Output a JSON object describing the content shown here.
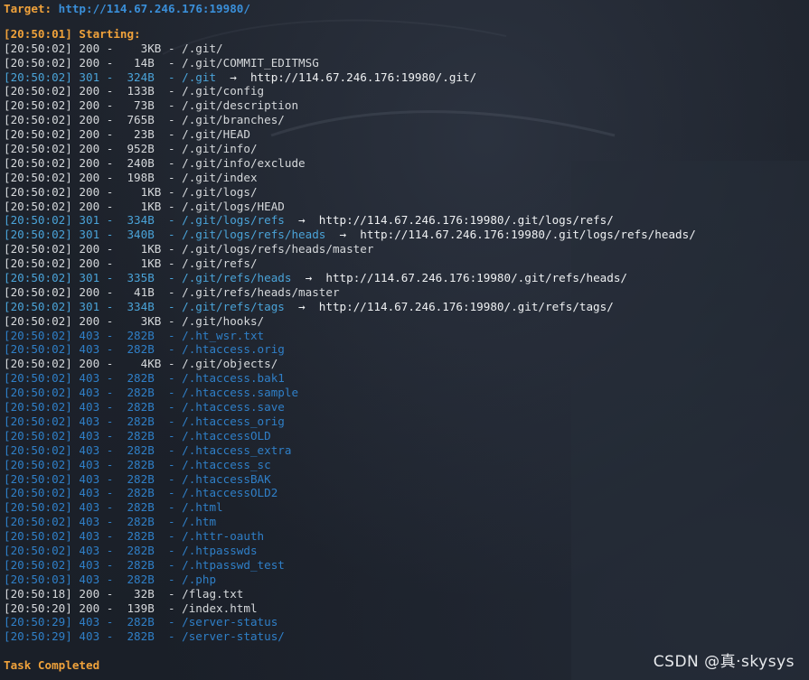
{
  "target_label": "Target:",
  "target_url": "http://114.67.246.176:19980/",
  "starting": "[20:50:01] Starting:",
  "lines": [
    {
      "code": "200",
      "t": "[20:50:02] 200 -    3KB - /.git/"
    },
    {
      "code": "200",
      "t": "[20:50:02] 200 -   14B  - /.git/COMMIT_EDITMSG"
    },
    {
      "code": "301",
      "t": "[20:50:02] 301 -  324B  - /.git  →  http://114.67.246.176:19980/.git/"
    },
    {
      "code": "200",
      "t": "[20:50:02] 200 -  133B  - /.git/config"
    },
    {
      "code": "200",
      "t": "[20:50:02] 200 -   73B  - /.git/description"
    },
    {
      "code": "200",
      "t": "[20:50:02] 200 -  765B  - /.git/branches/"
    },
    {
      "code": "200",
      "t": "[20:50:02] 200 -   23B  - /.git/HEAD"
    },
    {
      "code": "200",
      "t": "[20:50:02] 200 -  952B  - /.git/info/"
    },
    {
      "code": "200",
      "t": "[20:50:02] 200 -  240B  - /.git/info/exclude"
    },
    {
      "code": "200",
      "t": "[20:50:02] 200 -  198B  - /.git/index"
    },
    {
      "code": "200",
      "t": "[20:50:02] 200 -    1KB - /.git/logs/"
    },
    {
      "code": "200",
      "t": "[20:50:02] 200 -    1KB - /.git/logs/HEAD"
    },
    {
      "code": "301",
      "t": "[20:50:02] 301 -  334B  - /.git/logs/refs  →  http://114.67.246.176:19980/.git/logs/refs/"
    },
    {
      "code": "301",
      "t": "[20:50:02] 301 -  340B  - /.git/logs/refs/heads  →  http://114.67.246.176:19980/.git/logs/refs/heads/"
    },
    {
      "code": "200",
      "t": "[20:50:02] 200 -    1KB - /.git/logs/refs/heads/master"
    },
    {
      "code": "200",
      "t": "[20:50:02] 200 -    1KB - /.git/refs/"
    },
    {
      "code": "301",
      "t": "[20:50:02] 301 -  335B  - /.git/refs/heads  →  http://114.67.246.176:19980/.git/refs/heads/"
    },
    {
      "code": "200",
      "t": "[20:50:02] 200 -   41B  - /.git/refs/heads/master"
    },
    {
      "code": "301",
      "t": "[20:50:02] 301 -  334B  - /.git/refs/tags  →  http://114.67.246.176:19980/.git/refs/tags/"
    },
    {
      "code": "200",
      "t": "[20:50:02] 200 -    3KB - /.git/hooks/"
    },
    {
      "code": "403",
      "t": "[20:50:02] 403 -  282B  - /.ht_wsr.txt"
    },
    {
      "code": "403",
      "t": "[20:50:02] 403 -  282B  - /.htaccess.orig"
    },
    {
      "code": "200",
      "t": "[20:50:02] 200 -    4KB - /.git/objects/"
    },
    {
      "code": "403",
      "t": "[20:50:02] 403 -  282B  - /.htaccess.bak1"
    },
    {
      "code": "403",
      "t": "[20:50:02] 403 -  282B  - /.htaccess.sample"
    },
    {
      "code": "403",
      "t": "[20:50:02] 403 -  282B  - /.htaccess.save"
    },
    {
      "code": "403",
      "t": "[20:50:02] 403 -  282B  - /.htaccess_orig"
    },
    {
      "code": "403",
      "t": "[20:50:02] 403 -  282B  - /.htaccessOLD"
    },
    {
      "code": "403",
      "t": "[20:50:02] 403 -  282B  - /.htaccess_extra"
    },
    {
      "code": "403",
      "t": "[20:50:02] 403 -  282B  - /.htaccess_sc"
    },
    {
      "code": "403",
      "t": "[20:50:02] 403 -  282B  - /.htaccessBAK"
    },
    {
      "code": "403",
      "t": "[20:50:02] 403 -  282B  - /.htaccessOLD2"
    },
    {
      "code": "403",
      "t": "[20:50:02] 403 -  282B  - /.html"
    },
    {
      "code": "403",
      "t": "[20:50:02] 403 -  282B  - /.htm"
    },
    {
      "code": "403",
      "t": "[20:50:02] 403 -  282B  - /.httr-oauth"
    },
    {
      "code": "403",
      "t": "[20:50:02] 403 -  282B  - /.htpasswds"
    },
    {
      "code": "403",
      "t": "[20:50:02] 403 -  282B  - /.htpasswd_test"
    },
    {
      "code": "403",
      "t": "[20:50:03] 403 -  282B  - /.php"
    },
    {
      "code": "200",
      "t": "[20:50:18] 200 -   32B  - /flag.txt"
    },
    {
      "code": "200",
      "t": "[20:50:20] 200 -  139B  - /index.html"
    },
    {
      "code": "403",
      "t": "[20:50:29] 403 -  282B  - /server-status"
    },
    {
      "code": "403",
      "t": "[20:50:29] 403 -  282B  - /server-status/"
    }
  ],
  "task_completed": "Task Completed",
  "watermark": "CSDN @真·skysys",
  "colors": {
    "background": "#1b2029",
    "orange": "#f0a23b",
    "status_200": "#d5d8db",
    "status_301": "#4aa3d8",
    "status_403": "#2f7fc7",
    "target_url": "#3a8fd9"
  }
}
